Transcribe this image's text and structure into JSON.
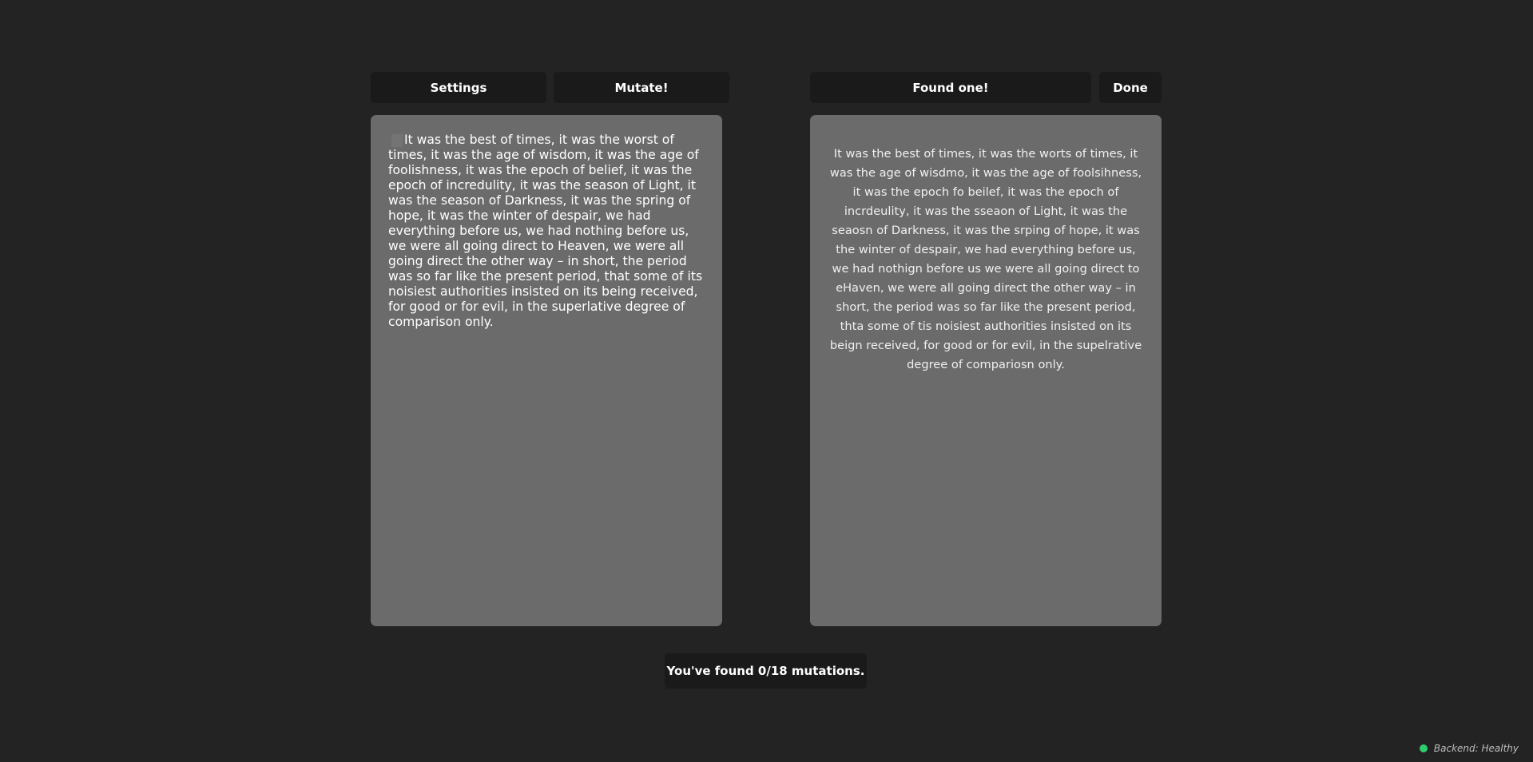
{
  "toolbar": {
    "settings_label": "Settings",
    "mutate_label": "Mutate!",
    "found_label": "Found one!",
    "done_label": "Done"
  },
  "original": {
    "text": "It was the best of times, it was the worst of times, it was the age of wisdom, it was the age of foolishness, it was the epoch of belief, it was the epoch of incredulity, it was the season of Light, it was the season of Darkness, it was the spring of hope, it was the winter of despair, we had everything before us, we had nothing before us, we were all going direct to Heaven, we were all going direct the other way – in short, the period was so far like the present period, that some of its noisiest authorities insisted on its being received, for good or for evil, in the superlative degree of comparison only."
  },
  "mutated": {
    "text": "It was the best of times, it was the worts of times, it was the age of wisdmo, it was the age of foolsihness, it was the epoch fo beilef, it was the epoch of incrdeulity, it was the sseaon of Light, it was the seaosn of Darkness, it was the srping of hope, it was the winter of despair, we had everything before us, we had nothign before us we were all going direct to eHaven, we were all going direct the other way – in short, the period was so far like the present period, thta some of tis noisiest authorities insisted on its beign received, for good or for evil, in the supelrative degree of compariosn only."
  },
  "progress": {
    "text": "You've found 0/18 mutations.",
    "found": 0,
    "total": 18
  },
  "status": {
    "text": "Backend: Healthy",
    "color": "#2ecc71"
  }
}
